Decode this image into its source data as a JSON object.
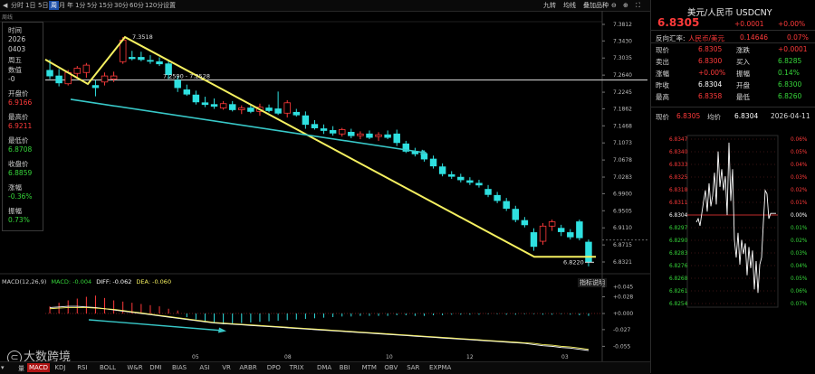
{
  "toolbar": {
    "items": [
      {
        "label": "分时",
        "active": false
      },
      {
        "label": "1日",
        "active": false
      },
      {
        "label": "5日",
        "active": false
      },
      {
        "label": "周",
        "active": true
      },
      {
        "label": "月",
        "active": false
      },
      {
        "label": "年",
        "active": false
      },
      {
        "label": "1分",
        "active": false
      },
      {
        "label": "5分",
        "active": false
      },
      {
        "label": "15分",
        "active": false
      },
      {
        "label": "30分",
        "active": false
      },
      {
        "label": "60分",
        "active": false
      },
      {
        "label": "120分",
        "active": false
      },
      {
        "label": "设置",
        "active": false
      }
    ],
    "right_items": [
      "九转",
      "均线",
      "叠加品种"
    ]
  },
  "chart_label": "周线",
  "info_panel": {
    "time_label": "时间",
    "date_year": "2026",
    "date_md": "0403",
    "weekday": "周五",
    "count_label": "数值",
    "count_value": "-0",
    "open_label": "开盘价",
    "open_value": "6.9166",
    "high_label": "最高价",
    "high_value": "6.9211",
    "low_label": "最低价",
    "low_value": "6.8708",
    "close_label": "收盘价",
    "close_value": "6.8859",
    "change_label": "涨幅",
    "change_value": "-0.36%",
    "amp_label": "振幅",
    "amp_value": "0.73%"
  },
  "price_axis_ticks": [
    "7.3812",
    "7.3430",
    "7.3035",
    "7.2640",
    "7.2245",
    "7.1862",
    "7.1468",
    "7.1073",
    "7.0678",
    "7.0283",
    "6.9900",
    "6.9505",
    "6.9110",
    "6.8715",
    "6.8321"
  ],
  "annotations": {
    "peak": "7.3518",
    "mid": "7.2590 - 7.2528",
    "low": "6.8220"
  },
  "macd": {
    "header": "MACD(12,26,9)",
    "macd_value": "MACD: -0.004",
    "diff_value": "DIFF: -0.062",
    "dea_value": "DEA: -0.060",
    "indicator_link": "指标说明",
    "axis_ticks": [
      "+0.045",
      "+0.028",
      "+0.000",
      "-0.027",
      "-0.055"
    ]
  },
  "x_axis_labels": [
    "05",
    "08",
    "10",
    "12",
    "03"
  ],
  "bottom_tabs": [
    {
      "label": "量",
      "active": false
    },
    {
      "label": "MACD",
      "active": true
    },
    {
      "label": "KDJ",
      "active": false
    },
    {
      "label": "RSI",
      "active": false
    },
    {
      "label": "BOLL",
      "active": false
    },
    {
      "label": "W&R",
      "active": false
    },
    {
      "label": "DMI",
      "active": false
    },
    {
      "label": "BIAS",
      "active": false
    },
    {
      "label": "ASI",
      "active": false
    },
    {
      "label": "VR",
      "active": false
    },
    {
      "label": "ARBR",
      "active": false
    },
    {
      "label": "DPO",
      "active": false
    },
    {
      "label": "TRIX",
      "active": false
    },
    {
      "label": "DMA",
      "active": false
    },
    {
      "label": "BBI",
      "active": false
    },
    {
      "label": "MTM",
      "active": false
    },
    {
      "label": "OBV",
      "active": false
    },
    {
      "label": "SAR",
      "active": false
    },
    {
      "label": "EXPMA",
      "active": false
    }
  ],
  "watermark": "大数跨境",
  "right_panel": {
    "title": "美元/人民币 USDCNY",
    "price": "6.8305",
    "change": "+0.0001",
    "change_pct": "+0.00%",
    "ref_label": "反向汇率:",
    "ref_pair": "人民币/美元",
    "ref_value": "0.14646",
    "ref_pct": "0.07%",
    "quote_rows": [
      {
        "l1": "现价",
        "v1": "6.8305",
        "l2": "涨跌",
        "v2": "+0.0001"
      },
      {
        "l1": "卖出",
        "v1": "6.8300",
        "l2": "买入",
        "v2": "6.8285"
      },
      {
        "l1": "涨幅",
        "v1": "+0.00%",
        "l2": "振幅",
        "v2": "0.14%"
      },
      {
        "l1": "昨收",
        "v1": "6.8304",
        "l2": "开盘",
        "v2": "6.8300"
      },
      {
        "l1": "最高",
        "v1": "6.8358",
        "l2": "最低",
        "v2": "6.8260"
      }
    ],
    "mini_header": {
      "price_label": "现价",
      "price": "6.8305",
      "avg_label": "均价",
      "avg": "6.8304",
      "date": "2026-04-11"
    },
    "mini_left_ticks": [
      "6.8347",
      "6.8340",
      "6.8333",
      "6.8325",
      "6.8318",
      "6.8311",
      "6.8304",
      "6.8297",
      "6.8290",
      "6.8283",
      "6.8276",
      "6.8268",
      "6.8261",
      "6.8254"
    ],
    "mini_right_ticks": [
      "0.06%",
      "0.05%",
      "0.04%",
      "0.03%",
      "0.02%",
      "0.01%",
      "0.00%",
      "0.01%",
      "0.02%",
      "0.03%",
      "0.04%",
      "0.05%",
      "0.06%",
      "0.07%"
    ]
  },
  "colors": {
    "up": "#ff3a3a",
    "down": "#2fe0e0",
    "trendline": "#f5f060",
    "arrow": "#38c8c8",
    "text_up": "#ff3a3a",
    "text_down": "#36d63a"
  },
  "chart_data": [
    {
      "type": "candlestick",
      "title": "",
      "y_axis_ticks": [
        7.3812,
        7.343,
        7.3035,
        7.264,
        7.2245,
        7.1862,
        7.1468,
        7.1073,
        7.0678,
        7.0283,
        6.99,
        6.9505,
        6.911,
        6.8715,
        6.8321
      ],
      "ylim": [
        6.8321,
        7.3812
      ],
      "x_ticks": [
        "05",
        "08",
        "10",
        "12",
        "03"
      ],
      "candles": [
        {
          "o": 7.275,
          "h": 7.3,
          "l": 7.255,
          "c": 7.262
        },
        {
          "o": 7.262,
          "h": 7.278,
          "l": 7.238,
          "c": 7.246
        },
        {
          "o": 7.244,
          "h": 7.276,
          "l": 7.24,
          "c": 7.27
        },
        {
          "o": 7.268,
          "h": 7.285,
          "l": 7.255,
          "c": 7.28
        },
        {
          "o": 7.27,
          "h": 7.292,
          "l": 7.258,
          "c": 7.287
        },
        {
          "o": 7.24,
          "h": 7.252,
          "l": 7.215,
          "c": 7.235
        },
        {
          "o": 7.248,
          "h": 7.27,
          "l": 7.24,
          "c": 7.262
        },
        {
          "o": 7.255,
          "h": 7.272,
          "l": 7.248,
          "c": 7.262
        },
        {
          "o": 7.295,
          "h": 7.352,
          "l": 7.29,
          "c": 7.345
        },
        {
          "o": 7.305,
          "h": 7.32,
          "l": 7.298,
          "c": 7.302
        },
        {
          "o": 7.305,
          "h": 7.318,
          "l": 7.296,
          "c": 7.3
        },
        {
          "o": 7.298,
          "h": 7.31,
          "l": 7.29,
          "c": 7.296
        },
        {
          "o": 7.295,
          "h": 7.305,
          "l": 7.285,
          "c": 7.29
        },
        {
          "o": 7.29,
          "h": 7.3,
          "l": 7.255,
          "c": 7.265
        },
        {
          "o": 7.252,
          "h": 7.262,
          "l": 7.225,
          "c": 7.235
        },
        {
          "o": 7.23,
          "h": 7.242,
          "l": 7.216,
          "c": 7.22
        },
        {
          "o": 7.218,
          "h": 7.228,
          "l": 7.196,
          "c": 7.202
        },
        {
          "o": 7.2,
          "h": 7.214,
          "l": 7.19,
          "c": 7.196
        },
        {
          "o": 7.196,
          "h": 7.21,
          "l": 7.186,
          "c": 7.192
        },
        {
          "o": 7.188,
          "h": 7.204,
          "l": 7.184,
          "c": 7.198
        },
        {
          "o": 7.196,
          "h": 7.204,
          "l": 7.18,
          "c": 7.184
        },
        {
          "o": 7.184,
          "h": 7.194,
          "l": 7.174,
          "c": 7.188
        },
        {
          "o": 7.188,
          "h": 7.196,
          "l": 7.176,
          "c": 7.18
        },
        {
          "o": 7.18,
          "h": 7.198,
          "l": 7.17,
          "c": 7.19
        },
        {
          "o": 7.188,
          "h": 7.196,
          "l": 7.178,
          "c": 7.182
        },
        {
          "o": 7.186,
          "h": 7.226,
          "l": 7.172,
          "c": 7.176
        },
        {
          "o": 7.176,
          "h": 7.206,
          "l": 7.166,
          "c": 7.2
        },
        {
          "o": 7.178,
          "h": 7.186,
          "l": 7.168,
          "c": 7.172
        },
        {
          "o": 7.17,
          "h": 7.18,
          "l": 7.14,
          "c": 7.15
        },
        {
          "o": 7.15,
          "h": 7.16,
          "l": 7.138,
          "c": 7.142
        },
        {
          "o": 7.14,
          "h": 7.15,
          "l": 7.128,
          "c": 7.136
        },
        {
          "o": 7.136,
          "h": 7.146,
          "l": 7.124,
          "c": 7.13
        },
        {
          "o": 7.128,
          "h": 7.142,
          "l": 7.122,
          "c": 7.138
        },
        {
          "o": 7.132,
          "h": 7.14,
          "l": 7.118,
          "c": 7.124
        },
        {
          "o": 7.124,
          "h": 7.134,
          "l": 7.116,
          "c": 7.128
        },
        {
          "o": 7.128,
          "h": 7.136,
          "l": 7.116,
          "c": 7.12
        },
        {
          "o": 7.122,
          "h": 7.132,
          "l": 7.112,
          "c": 7.126
        },
        {
          "o": 7.126,
          "h": 7.136,
          "l": 7.116,
          "c": 7.12
        },
        {
          "o": 7.128,
          "h": 7.138,
          "l": 7.1,
          "c": 7.108
        },
        {
          "o": 7.105,
          "h": 7.112,
          "l": 7.084,
          "c": 7.088
        },
        {
          "o": 7.088,
          "h": 7.096,
          "l": 7.076,
          "c": 7.082
        },
        {
          "o": 7.082,
          "h": 7.09,
          "l": 7.064,
          "c": 7.07
        },
        {
          "o": 7.07,
          "h": 7.078,
          "l": 7.048,
          "c": 7.054
        },
        {
          "o": 7.052,
          "h": 7.06,
          "l": 7.03,
          "c": 7.036
        },
        {
          "o": 7.034,
          "h": 7.042,
          "l": 7.024,
          "c": 7.03
        },
        {
          "o": 7.028,
          "h": 7.036,
          "l": 7.016,
          "c": 7.022
        },
        {
          "o": 7.02,
          "h": 7.028,
          "l": 7.01,
          "c": 7.016
        },
        {
          "o": 7.014,
          "h": 7.022,
          "l": 7.004,
          "c": 7.01
        },
        {
          "o": 7.0,
          "h": 7.01,
          "l": 6.982,
          "c": 6.988
        },
        {
          "o": 6.986,
          "h": 6.994,
          "l": 6.968,
          "c": 6.974
        },
        {
          "o": 6.972,
          "h": 6.98,
          "l": 6.95,
          "c": 6.956
        },
        {
          "o": 6.954,
          "h": 6.962,
          "l": 6.924,
          "c": 6.93
        },
        {
          "o": 6.928,
          "h": 6.936,
          "l": 6.912,
          "c": 6.918
        },
        {
          "o": 6.9,
          "h": 6.91,
          "l": 6.858,
          "c": 6.868
        },
        {
          "o": 6.88,
          "h": 6.922,
          "l": 6.872,
          "c": 6.915
        },
        {
          "o": 6.915,
          "h": 6.93,
          "l": 6.904,
          "c": 6.925
        },
        {
          "o": 6.91,
          "h": 6.918,
          "l": 6.892,
          "c": 6.902
        },
        {
          "o": 6.9,
          "h": 6.908,
          "l": 6.884,
          "c": 6.89
        },
        {
          "o": 6.925,
          "h": 6.93,
          "l": 6.882,
          "c": 6.888
        },
        {
          "o": 6.878,
          "h": 6.884,
          "l": 6.822,
          "c": 6.832
        }
      ]
    },
    {
      "type": "bar",
      "title": "MACD(12,26,9)",
      "y_axis_ticks": [
        0.045,
        0.028,
        0.0,
        -0.027,
        -0.055
      ],
      "ylim": [
        -0.062,
        0.05
      ],
      "series": [
        {
          "name": "MACD",
          "values": [
            0.012,
            0.018,
            0.022,
            0.025,
            0.028,
            0.03,
            0.026,
            0.022,
            0.02,
            0.018,
            0.016,
            0.014,
            0.012,
            0.008,
            0.005,
            -0.006,
            -0.01,
            -0.014,
            -0.016,
            -0.018,
            -0.017,
            -0.016,
            -0.015,
            -0.014,
            -0.013,
            -0.012,
            -0.011,
            -0.01,
            -0.009,
            -0.008,
            -0.007,
            -0.006,
            -0.005,
            -0.005,
            -0.004,
            -0.004,
            -0.004,
            -0.004,
            -0.003,
            -0.003,
            -0.004,
            -0.004,
            -0.003,
            -0.003,
            -0.002,
            -0.002,
            -0.002,
            -0.002,
            -0.001,
            -0.001,
            -0.002,
            -0.002,
            -0.001,
            -0.001,
            -0.002,
            -0.002,
            -0.001,
            -0.002,
            -0.003,
            -0.004
          ]
        },
        {
          "name": "DIFF",
          "values": [
            0.01,
            0.011,
            0.012,
            0.012,
            0.011,
            0.01,
            0.008,
            0.006,
            0.004,
            0.002,
            0.0,
            -0.002,
            -0.004,
            -0.006,
            -0.008,
            -0.01,
            -0.012,
            -0.014,
            -0.016,
            -0.017,
            -0.018,
            -0.019,
            -0.02,
            -0.021,
            -0.022,
            -0.023,
            -0.024,
            -0.025,
            -0.026,
            -0.027,
            -0.028,
            -0.029,
            -0.03,
            -0.031,
            -0.032,
            -0.033,
            -0.034,
            -0.035,
            -0.036,
            -0.037,
            -0.038,
            -0.039,
            -0.04,
            -0.041,
            -0.042,
            -0.043,
            -0.044,
            -0.045,
            -0.046,
            -0.047,
            -0.048,
            -0.049,
            -0.05,
            -0.052,
            -0.054,
            -0.055,
            -0.057,
            -0.058,
            -0.06,
            -0.062
          ]
        },
        {
          "name": "DEA",
          "values": [
            0.008,
            0.009,
            0.01,
            0.01,
            0.01,
            0.009,
            0.008,
            0.007,
            0.005,
            0.003,
            0.001,
            -0.001,
            -0.003,
            -0.005,
            -0.007,
            -0.009,
            -0.011,
            -0.013,
            -0.015,
            -0.016,
            -0.017,
            -0.018,
            -0.019,
            -0.02,
            -0.021,
            -0.022,
            -0.023,
            -0.024,
            -0.025,
            -0.026,
            -0.027,
            -0.028,
            -0.029,
            -0.03,
            -0.031,
            -0.032,
            -0.033,
            -0.034,
            -0.035,
            -0.036,
            -0.037,
            -0.038,
            -0.039,
            -0.04,
            -0.041,
            -0.042,
            -0.043,
            -0.044,
            -0.045,
            -0.046,
            -0.047,
            -0.048,
            -0.049,
            -0.05,
            -0.052,
            -0.053,
            -0.055,
            -0.056,
            -0.058,
            -0.06
          ]
        }
      ]
    },
    {
      "type": "line",
      "title": "",
      "ylim": [
        6.8254,
        6.8347
      ],
      "series": [
        {
          "name": "",
          "values": [
            6.83,
            6.8302,
            6.8298,
            6.8305,
            6.8312,
            6.8318,
            6.8306,
            6.8322,
            6.8309,
            6.8315,
            6.8328,
            6.831,
            6.834,
            6.832,
            6.833,
            6.8318,
            6.8326,
            6.8304,
            6.8345,
            6.8312,
            6.833,
            6.829,
            6.828,
            6.8294,
            6.8276,
            6.829,
            6.8282,
            6.8288,
            6.827,
            6.8286,
            6.8274,
            6.8284,
            6.8262,
            6.8278,
            6.826,
            6.8276,
            6.828,
            6.83,
            6.8318,
            6.8316,
            6.8302,
            6.8305,
            6.8305,
            6.8305,
            6.8305
          ]
        }
      ]
    }
  ]
}
